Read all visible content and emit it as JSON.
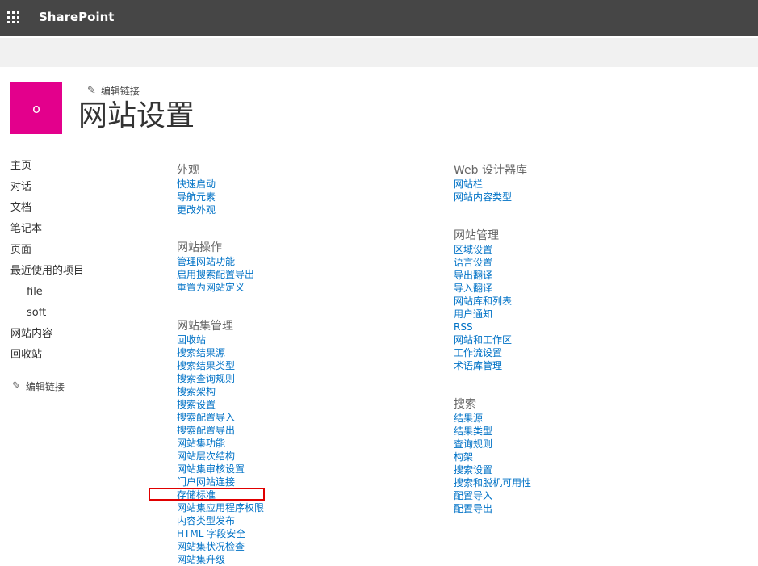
{
  "suitebar": {
    "app_launcher_icon": "waffle-grid-icon",
    "brand": "SharePoint"
  },
  "site": {
    "logo_letter": "o",
    "logo_color": "#e3008c",
    "edit_links_label": "编辑链接",
    "title": "网站设置"
  },
  "leftnav": {
    "items": [
      {
        "label": "主页"
      },
      {
        "label": "对话"
      },
      {
        "label": "文档"
      },
      {
        "label": "笔记本"
      },
      {
        "label": "页面"
      },
      {
        "label": "最近使用的项目"
      },
      {
        "label": "file"
      },
      {
        "label": "soft"
      },
      {
        "label": "网站内容"
      },
      {
        "label": "回收站"
      }
    ],
    "edit_links_label": "编辑链接"
  },
  "settings": {
    "look_and_feel": {
      "heading": "外观",
      "links": [
        "快速启动",
        "导航元素",
        "更改外观"
      ]
    },
    "site_actions": {
      "heading": "网站操作",
      "links": [
        "管理网站功能",
        "启用搜索配置导出",
        "重置为网站定义"
      ]
    },
    "site_collection_admin": {
      "heading": "网站集管理",
      "links": [
        "回收站",
        "搜索结果源",
        "搜索结果类型",
        "搜索查询规则",
        "搜索架构",
        "搜索设置",
        "搜索配置导入",
        "搜索配置导出",
        "网站集功能",
        "网站层次结构",
        "网站集审核设置",
        "门户网站连接",
        "存储标准",
        "网站集应用程序权限",
        "内容类型发布",
        "HTML 字段安全",
        "网站集状况检查",
        "网站集升级"
      ]
    },
    "web_designer_galleries": {
      "heading": "Web 设计器库",
      "links": [
        "网站栏",
        "网站内容类型"
      ]
    },
    "site_administration": {
      "heading": "网站管理",
      "links": [
        "区域设置",
        "语言设置",
        "导出翻译",
        "导入翻译",
        "网站库和列表",
        "用户通知",
        "RSS",
        "网站和工作区",
        "工作流设置",
        "术语库管理"
      ]
    },
    "search": {
      "heading": "搜索",
      "links": [
        "结果源",
        "结果类型",
        "查询规则",
        "构架",
        "搜索设置",
        "搜索和脱机可用性",
        "配置导入",
        "配置导出"
      ]
    }
  },
  "colors": {
    "suitebar_bg": "#464646",
    "link": "#0072c6",
    "highlight_box": "#e00000"
  }
}
